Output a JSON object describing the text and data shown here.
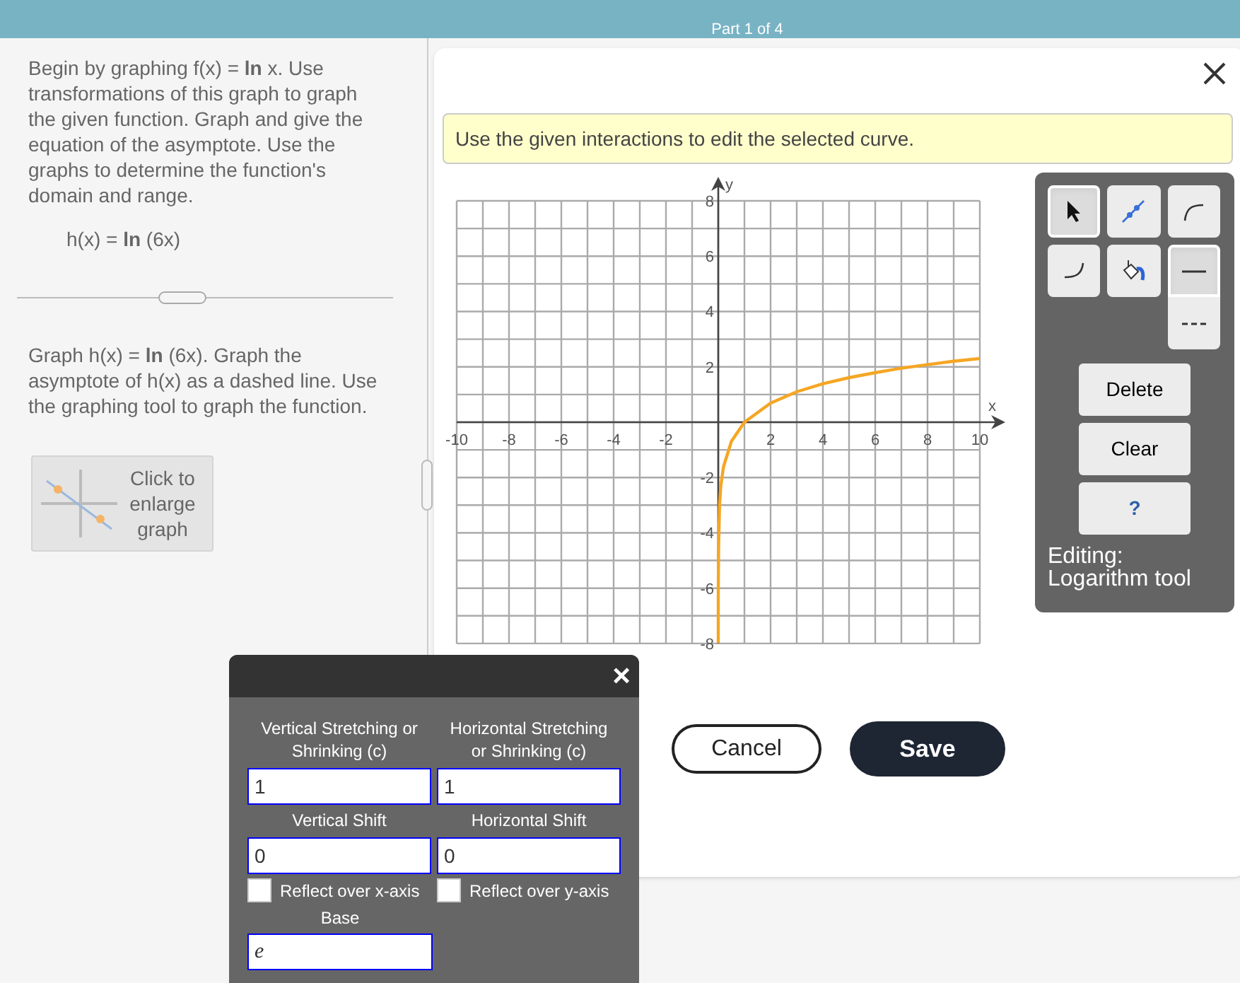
{
  "header": {
    "title": "Part 1 of 4"
  },
  "question": {
    "intro": "Begin by graphing f(x) = **ln** x. Use transformations of this graph to graph the given function. Graph and give the equation of the asymptote. Use the graphs to determine the function's domain and range.",
    "function": "h(x) = **ln** (6x)",
    "task": "Graph h(x) = **ln** (6x). Graph the asymptote of h(x) as a dashed line. Use the graphing tool to graph the function.",
    "enlarge_button": "Click to enlarge graph"
  },
  "dialog": {
    "instruction": "Use the given interactions to edit the selected curve.",
    "graph": {
      "chart_data": {
        "type": "line",
        "xlabel": "x",
        "ylabel": "y",
        "xlim": [
          -10,
          10
        ],
        "ylim": [
          -8,
          8
        ],
        "xticks": [
          -10,
          -8,
          -6,
          -4,
          -2,
          2,
          4,
          6,
          8,
          10
        ],
        "yticks": [
          -8,
          -6,
          -4,
          -2,
          2,
          4,
          6,
          8
        ],
        "x": [
          0.00034,
          0.002,
          0.01,
          0.05,
          0.1,
          0.2,
          0.5,
          1,
          2,
          3,
          4,
          5,
          6,
          7,
          8,
          9,
          10
        ],
        "grid": true,
        "series": [
          {
            "color": "#f5a623",
            "values": [
              -7.99,
              -6.21,
              -4.61,
              -3.0,
              -2.3,
              -1.61,
              -0.69,
              0,
              0.69,
              1.1,
              1.39,
              1.61,
              1.79,
              1.95,
              2.08,
              2.2,
              2.3
            ]
          }
        ]
      }
    },
    "tools": [
      {
        "kind": "select",
        "selected": true
      },
      {
        "kind": "line",
        "selected": false
      },
      {
        "kind": "curve-up",
        "selected": false
      },
      {
        "kind": "curve-down",
        "selected": false
      },
      {
        "kind": "fill",
        "selected": false
      },
      {
        "kind": "solid",
        "selected": true
      },
      {
        "kind": "dashed",
        "selected": false
      }
    ],
    "actions": [
      "Delete",
      "Clear",
      "?"
    ],
    "status": "Editing: Logarithm tool",
    "buttons": [
      {
        "label": "Cancel",
        "kind": "secondary"
      },
      {
        "label": "Save",
        "kind": "primary"
      }
    ]
  },
  "transform_panel": {
    "close": "×",
    "fields": [
      {
        "label": "Vertical Stretching or Shrinking (c)",
        "value": "1"
      },
      {
        "label": "Horizontal Stretching or Shrinking (c)",
        "value": "1"
      },
      {
        "label": "Vertical Shift",
        "value": "0"
      },
      {
        "label": "Horizontal Shift",
        "value": "0"
      }
    ],
    "checkboxes": [
      {
        "label": "Reflect over x-axis",
        "checked": false
      },
      {
        "label": "Reflect over y-axis",
        "checked": false
      }
    ],
    "base": {
      "label": "Base",
      "value": "e"
    }
  }
}
